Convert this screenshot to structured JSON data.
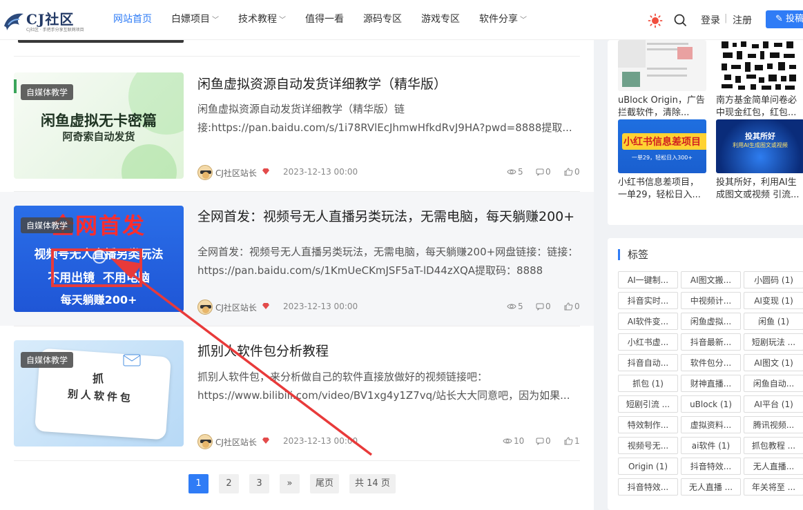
{
  "header": {
    "logo_text": "CJ社区",
    "logo_sub": "CJ社区 · 手把手分享互联网项目",
    "nav": [
      {
        "label": "网站首页",
        "dropdown": false,
        "active": true
      },
      {
        "label": "白嫖项目",
        "dropdown": true,
        "active": false
      },
      {
        "label": "技术教程",
        "dropdown": true,
        "active": false
      },
      {
        "label": "值得一看",
        "dropdown": false,
        "active": false
      },
      {
        "label": "源码专区",
        "dropdown": false,
        "active": false
      },
      {
        "label": "游戏专区",
        "dropdown": false,
        "active": false
      },
      {
        "label": "软件分享",
        "dropdown": true,
        "active": false
      }
    ],
    "login": "登录",
    "separator": "|",
    "register": "注册",
    "post_button": "投稿",
    "accent": "#2f7cf6"
  },
  "posts": [
    {
      "badge": "自媒体教学",
      "thumb_text_1": "闲鱼虚拟无卡密篇",
      "thumb_text_2": "阿奇索自动发货",
      "title": "闲鱼虚拟资源自动发货详细教学（精华版）",
      "excerpt": "闲鱼虚拟资源自动发货详细教学（精华版）链接:https://pan.baidu.com/s/1i78RVlEcJhmwHfkdRvJ9HA?pwd=8888提取...",
      "author": "CJ社区站长",
      "date": "2023-12-13 00:00",
      "views": "5",
      "comments": "0",
      "likes": "0"
    },
    {
      "badge": "自媒体教学",
      "thumb_text_1": "全网首发",
      "thumb_text_2": "视频号无人直播另类玩法",
      "thumb_text_3": "不用出镜  不用电脑",
      "thumb_text_4": "每天躺赚200+",
      "title": "全网首发：视频号无人直播另类玩法，无需电脑，每天躺赚200+",
      "excerpt": "全网首发：视频号无人直播另类玩法，无需电脑，每天躺赚200+网盘链接：链接：https://pan.baidu.com/s/1KmUeCKmJSF5aT-lD44zXQA提取码：8888",
      "author": "CJ社区站长",
      "date": "2023-12-13 00:00",
      "views": "5",
      "comments": "0",
      "likes": "0"
    },
    {
      "badge": "自媒体教学",
      "thumb_text_1": "抓",
      "thumb_text_2": "别人软件包",
      "title": "抓别人软件包分析教程",
      "excerpt": "抓别人软件包，来分析做自己的软件直接放做好的视频链接吧：https://www.bilibili.com/video/BV1xg4y1Z7vq/站长大大同意吧，因为如果...",
      "author": "CJ社区站长",
      "date": "2023-12-13 00:00",
      "views": "10",
      "comments": "0",
      "likes": "1"
    }
  ],
  "pagination": {
    "pages": [
      "1",
      "2",
      "3"
    ],
    "next": "»",
    "last": "尾页",
    "total": "共 14 页"
  },
  "sidebar": {
    "cards": [
      {
        "caption": "uBlock Origin，广告拦截软件，清除..."
      },
      {
        "caption": "南方基金简单问卷必中现金红包，红包..."
      },
      {
        "caption": "小红书信息差项目，一单29，轻松日入...",
        "thumb_text": "小红书信息差项目",
        "thumb_sub": "一单29，轻松日入300+"
      },
      {
        "caption": "投其所好，利用AI生成图文或视频 引流...",
        "thumb_text": "投其所好",
        "thumb_sub": "利用AI生成图文或视频"
      }
    ],
    "tags_title": "标签",
    "tags": [
      "AI一键制...",
      "AI图文搬...",
      "小圆码 (1)",
      "抖音实时...",
      "中视频计...",
      "AI变现 (1)",
      "AI软件变...",
      "闲鱼虚拟...",
      "闲鱼 (1)",
      "小红书虚...",
      "抖音最新...",
      "短剧玩法 ...",
      "抖音自动...",
      "软件包分...",
      "AI图文 (1)",
      "抓包 (1)",
      "财神直播...",
      "闲鱼自动...",
      "短剧引流 ...",
      "uBlock (1)",
      "AI平台 (1)",
      "特效制作...",
      "虚拟资料...",
      "腾讯视频...",
      "视频号无...",
      "ai软件 (1)",
      "抓包教程 ...",
      "Origin (1)",
      "抖音特效...",
      "无人直播...",
      "抖音特效...",
      "无人直播 ...",
      "年关将至 ..."
    ]
  }
}
